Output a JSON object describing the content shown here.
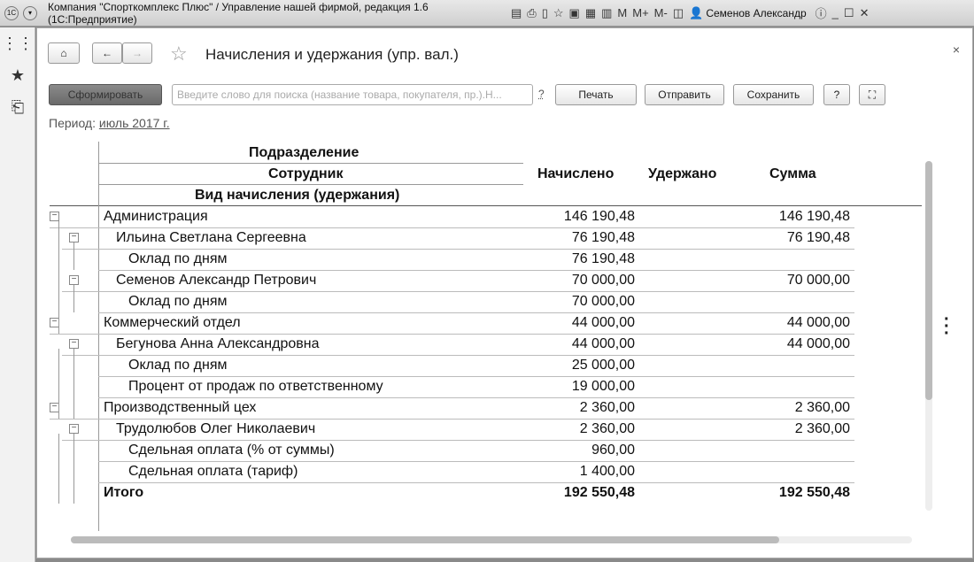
{
  "window": {
    "title": "Компания \"Спорткомплекс Плюс\" / Управление нашей фирмой, редакция 1.6  (1С:Предприятие)",
    "user": "Семенов Александр",
    "m": "M",
    "mplus": "M+",
    "mminus": "M-"
  },
  "form": {
    "title": "Начисления и удержания (упр. вал.)",
    "generate": "Сформировать",
    "search_placeholder": "Введите слово для поиска (название товара, покупателя, пр.).Н...",
    "help_q": "?",
    "print": "Печать",
    "send": "Отправить",
    "save": "Сохранить",
    "help": "?",
    "period_label": "Период:",
    "period_value": "июль 2017 г."
  },
  "table": {
    "headers": {
      "dept": "Подразделение",
      "employee": "Сотрудник",
      "kind": "Вид начисления (удержания)",
      "accrued": "Начислено",
      "withheld": "Удержано",
      "sum": "Сумма"
    },
    "rows": [
      {
        "level": 0,
        "name": "Администрация",
        "accrued": "146 190,48",
        "withheld": "",
        "sum": "146 190,48"
      },
      {
        "level": 1,
        "name": "Ильина Светлана Сергеевна",
        "accrued": "76 190,48",
        "withheld": "",
        "sum": "76 190,48"
      },
      {
        "level": 2,
        "name": "Оклад по дням",
        "accrued": "76 190,48",
        "withheld": "",
        "sum": ""
      },
      {
        "level": 1,
        "name": "Семенов Александр Петрович",
        "accrued": "70 000,00",
        "withheld": "",
        "sum": "70 000,00"
      },
      {
        "level": 2,
        "name": "Оклад по дням",
        "accrued": "70 000,00",
        "withheld": "",
        "sum": ""
      },
      {
        "level": 0,
        "name": "Коммерческий отдел",
        "accrued": "44 000,00",
        "withheld": "",
        "sum": "44 000,00"
      },
      {
        "level": 1,
        "name": "Бегунова Анна Александровна",
        "accrued": "44 000,00",
        "withheld": "",
        "sum": "44 000,00"
      },
      {
        "level": 2,
        "name": "Оклад по дням",
        "accrued": "25 000,00",
        "withheld": "",
        "sum": ""
      },
      {
        "level": 2,
        "name": "Процент от продаж по ответственному",
        "accrued": "19 000,00",
        "withheld": "",
        "sum": ""
      },
      {
        "level": 0,
        "name": "Производственный цех",
        "accrued": "2 360,00",
        "withheld": "",
        "sum": "2 360,00"
      },
      {
        "level": 1,
        "name": "Трудолюбов Олег Николаевич",
        "accrued": "2 360,00",
        "withheld": "",
        "sum": "2 360,00"
      },
      {
        "level": 2,
        "name": "Сдельная оплата (% от суммы)",
        "accrued": "960,00",
        "withheld": "",
        "sum": ""
      },
      {
        "level": 2,
        "name": "Сдельная оплата (тариф)",
        "accrued": "1 400,00",
        "withheld": "",
        "sum": ""
      }
    ],
    "total": {
      "name": "Итого",
      "accrued": "192 550,48",
      "withheld": "",
      "sum": "192 550,48"
    }
  }
}
